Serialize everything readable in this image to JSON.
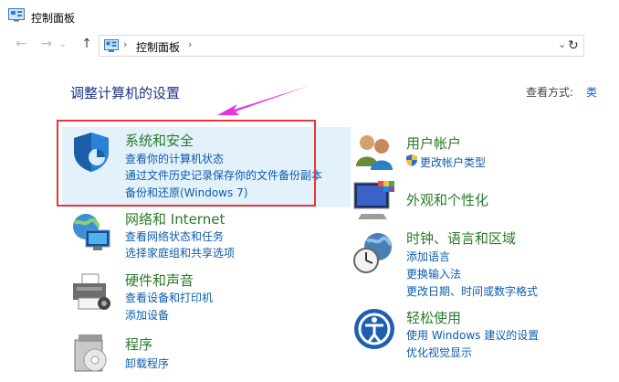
{
  "window": {
    "title": "控制面板"
  },
  "nav": {
    "back": "←",
    "forward": "→",
    "up": "↑",
    "breadcrumb": "控制面板",
    "sep": "›",
    "dropdown": "⌄",
    "refresh": "↻"
  },
  "main": {
    "heading": "调整计算机的设置",
    "view_by_label": "查看方式:",
    "view_by_value": "类"
  },
  "left_categories": [
    {
      "title": "系统和安全",
      "links": [
        "查看你的计算机状态",
        "通过文件历史记录保存你的文件备份副本",
        "备份和还原(Windows 7)"
      ]
    },
    {
      "title": "网络和 Internet",
      "links": [
        "查看网络状态和任务",
        "选择家庭组和共享选项"
      ]
    },
    {
      "title": "硬件和声音",
      "links": [
        "查看设备和打印机",
        "添加设备"
      ]
    },
    {
      "title": "程序",
      "links": [
        "卸载程序"
      ]
    }
  ],
  "right_categories": [
    {
      "title": "用户帐户",
      "links": [
        "更改帐户类型"
      ]
    },
    {
      "title": "外观和个性化",
      "links": []
    },
    {
      "title": "时钟、语言和区域",
      "links": [
        "添加语言",
        "更换输入法",
        "更改日期、时间或数字格式"
      ]
    },
    {
      "title": "轻松使用",
      "links": [
        "使用 Windows 建议的设置",
        "优化视觉显示"
      ]
    }
  ],
  "colors": {
    "highlight_box": "#e03a3a",
    "arrow": "#e834e0",
    "category_title": "#2a7a2a",
    "link": "#0b5cad"
  }
}
